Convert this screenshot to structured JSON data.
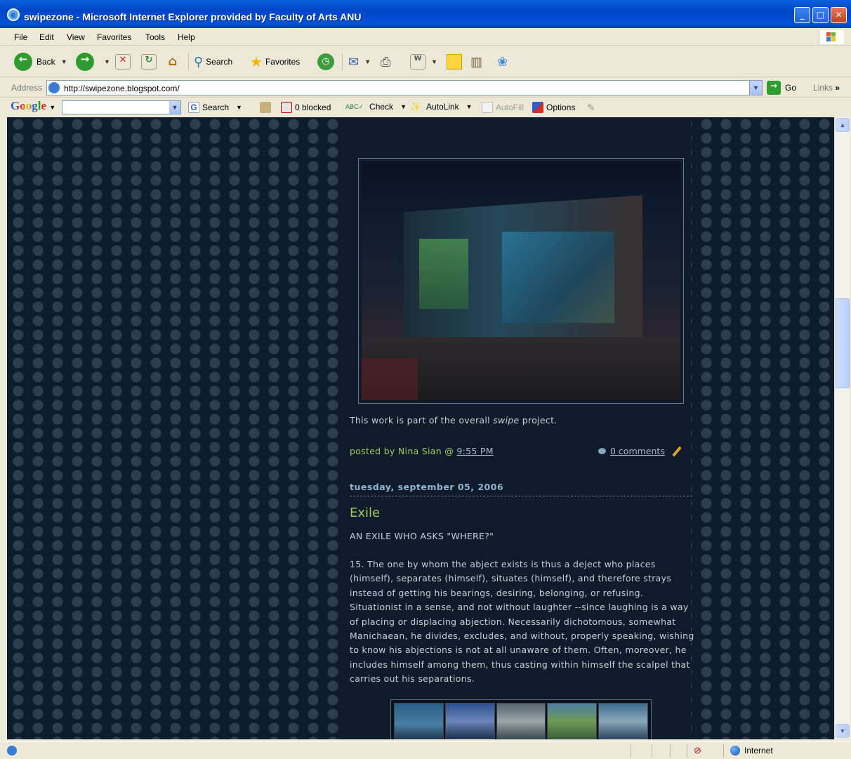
{
  "window": {
    "title": "swipezone - Microsoft Internet Explorer provided by Faculty of Arts ANU"
  },
  "menu": {
    "items": [
      "File",
      "Edit",
      "View",
      "Favorites",
      "Tools",
      "Help"
    ]
  },
  "toolbar": {
    "back": "Back",
    "search": "Search",
    "favorites": "Favorites"
  },
  "address": {
    "label": "Address",
    "url": "http://swipezone.blogspot.com/",
    "go": "Go",
    "links": "Links"
  },
  "google": {
    "logo": "Google",
    "search": "Search",
    "blocked": "0 blocked",
    "check": "Check",
    "autolink": "AutoLink",
    "autofill": "AutoFill",
    "options": "Options"
  },
  "post1": {
    "caption_pre": "This work is part of the overall ",
    "caption_em": "swipe",
    "caption_post": " project.",
    "posted_by": "posted by Nina Sian @ ",
    "time": "9:55 PM",
    "comments": "0 comments"
  },
  "post2": {
    "date": "tuesday, september 05, 2006",
    "title": "Exile",
    "subtitle": "AN EXILE WHO ASKS \"WHERE?\"",
    "body": "15. The one by whom the abject exists is thus a deject who places (himself), separates (himself), situates (himself), and therefore strays instead of getting his bearings, desiring, belonging, or refusing. Situationist in a sense, and not without laughter --since laughing is a way of placing or displacing abjection. Necessarily dichotomous, somewhat Manichaean, he divides, excludes, and without, properly speaking, wishing to know his abjections is not at all unaware of them. Often, moreover, he includes himself among them, thus casting within himself the scalpel that carries out his separations."
  },
  "status": {
    "zone": "Internet"
  },
  "colors": {
    "page_bg": "#0f1c2c",
    "accent_green": "#9ccb61",
    "date_blue": "#8eb6cf",
    "text": "#c7cfd6"
  }
}
